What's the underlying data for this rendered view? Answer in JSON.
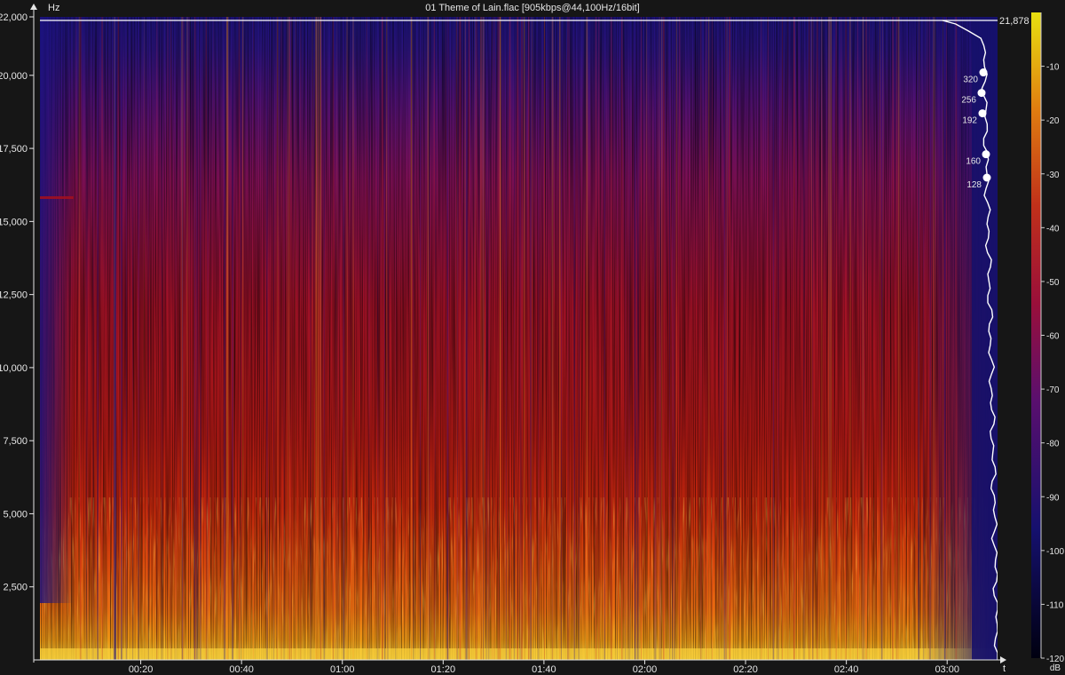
{
  "window": {
    "title": "01 Theme of Lain.flac [905kbps@44,100Hz/16bit]"
  },
  "chart_data": {
    "type": "heatmap",
    "title": "01 Theme of Lain.flac [905kbps@44,100Hz/16bit]",
    "xlabel": "t",
    "ylabel": "Hz",
    "colorbar_label": "dB",
    "x_ticks": [
      "00:20",
      "00:40",
      "01:00",
      "01:20",
      "01:40",
      "02:00",
      "02:20",
      "02:40",
      "03:00"
    ],
    "x_tick_seconds": [
      20,
      40,
      60,
      80,
      100,
      120,
      140,
      160,
      180
    ],
    "xlim": [
      0,
      190
    ],
    "y_ticks": [
      "22,000",
      "20,000",
      "17,500",
      "15,000",
      "12,500",
      "10,000",
      "7,500",
      "5,000",
      "2,500"
    ],
    "y_tick_values": [
      22000,
      20000,
      17500,
      15000,
      12500,
      10000,
      7500,
      5000,
      2500
    ],
    "ylim": [
      0,
      22000
    ],
    "colorbar_ticks": [
      "-10",
      "-20",
      "-30",
      "-40",
      "-50",
      "-60",
      "-70",
      "-80",
      "-90",
      "-100",
      "-110",
      "-120"
    ],
    "colorbar_values": [
      -10,
      -20,
      -30,
      -40,
      -50,
      -60,
      -70,
      -80,
      -90,
      -100,
      -110,
      -120
    ],
    "colorbar_range": [
      -120,
      0
    ],
    "cutoff_label": "21,878",
    "cutoff_value": 21878,
    "bitrate_markers": [
      {
        "label": "320",
        "freq": 20100
      },
      {
        "label": "256",
        "freq": 19400
      },
      {
        "label": "192",
        "freq": 18700
      },
      {
        "label": "160",
        "freq": 17300
      },
      {
        "label": "128",
        "freq": 16500
      }
    ],
    "colors": {
      "background": "#161616",
      "colormap": [
        "#000010",
        "#15106e",
        "#6a0f6b",
        "#c0102d",
        "#f15d0f",
        "#fbb60a",
        "#ffff66"
      ],
      "axis": "#e6e6e6"
    }
  }
}
